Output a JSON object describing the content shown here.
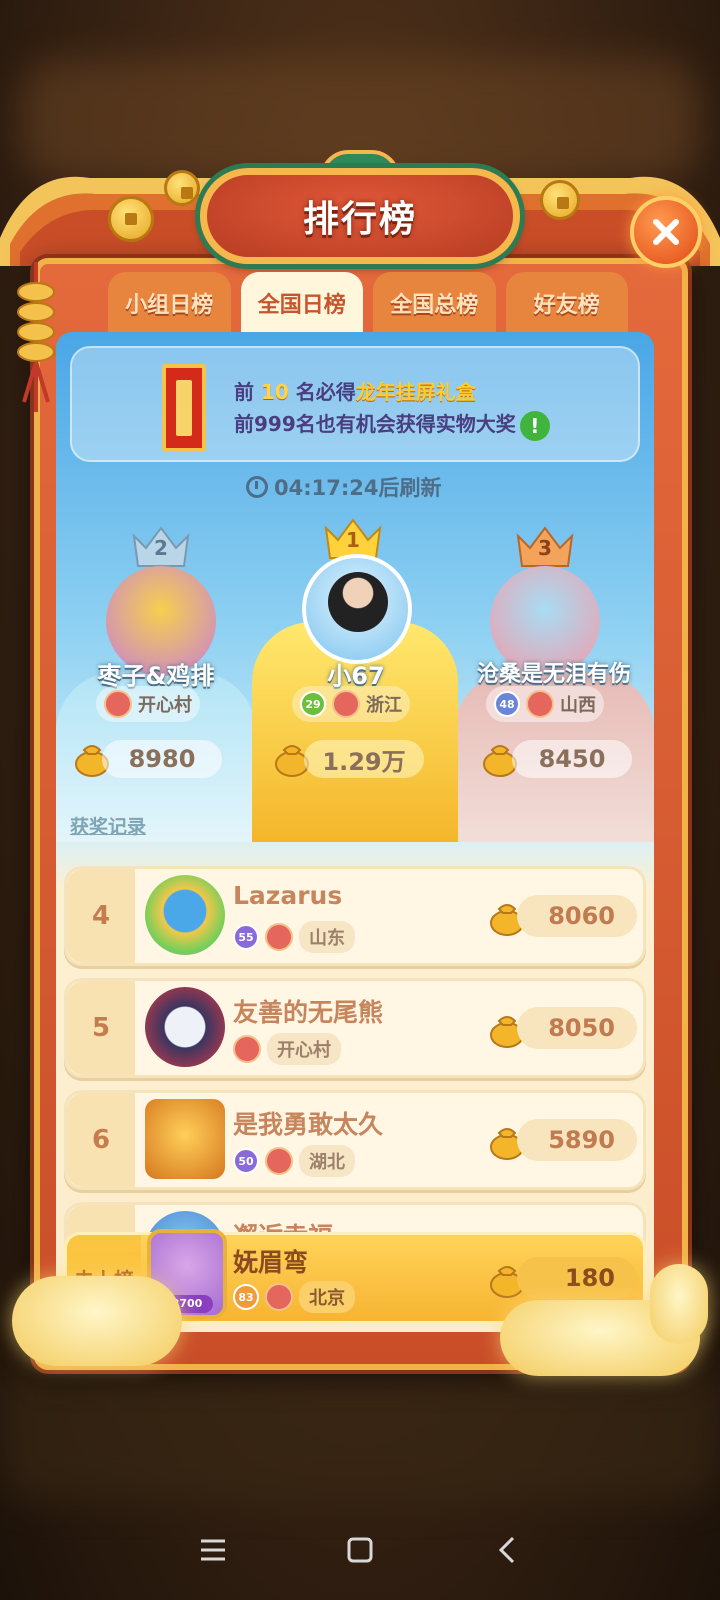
{
  "header": {
    "title": "排行榜"
  },
  "tabs": [
    {
      "label": "小组日榜",
      "active": false
    },
    {
      "label": "全国日榜",
      "active": true
    },
    {
      "label": "全国总榜",
      "active": false
    },
    {
      "label": "好友榜",
      "active": false
    }
  ],
  "notice": {
    "line1_prefix": "前 ",
    "line1_num": "10",
    "line1_mid": " 名必得",
    "line1_prize": "龙年挂屏礼盒",
    "line2": "前999名也有机会获得实物大奖",
    "info_icon": "!"
  },
  "timer": {
    "text": "04:17:24后刷新"
  },
  "top3": [
    {
      "rank": "2",
      "name": "枣子&鸡排",
      "level": "",
      "location": "开心村",
      "score": "8980"
    },
    {
      "rank": "1",
      "name": "小67",
      "level": "29",
      "location": "浙江",
      "score": "1.29万"
    },
    {
      "rank": "3",
      "name": "沧桑是无泪有伤",
      "level": "48",
      "location": "山西",
      "score": "8450"
    }
  ],
  "award_link": "获奖记录",
  "list": [
    {
      "rank": "4",
      "name": "Lazarus",
      "level": "55",
      "location": "山东",
      "score": "8060"
    },
    {
      "rank": "5",
      "name": "友善的无尾熊",
      "level": "",
      "location": "开心村",
      "score": "8050"
    },
    {
      "rank": "6",
      "name": "是我勇敢太久",
      "level": "50",
      "location": "湖北",
      "score": "5890"
    }
  ],
  "partial_row": {
    "name": "邂逅幸福"
  },
  "self": {
    "rank": "未上榜",
    "name": "妩眉弯",
    "level": "83",
    "avatar_badge": "2700",
    "location": "北京",
    "score": "180"
  },
  "colors": {
    "accent": "#e46a3c",
    "gold": "#f6b84c",
    "sky": "#4aa6e6"
  }
}
